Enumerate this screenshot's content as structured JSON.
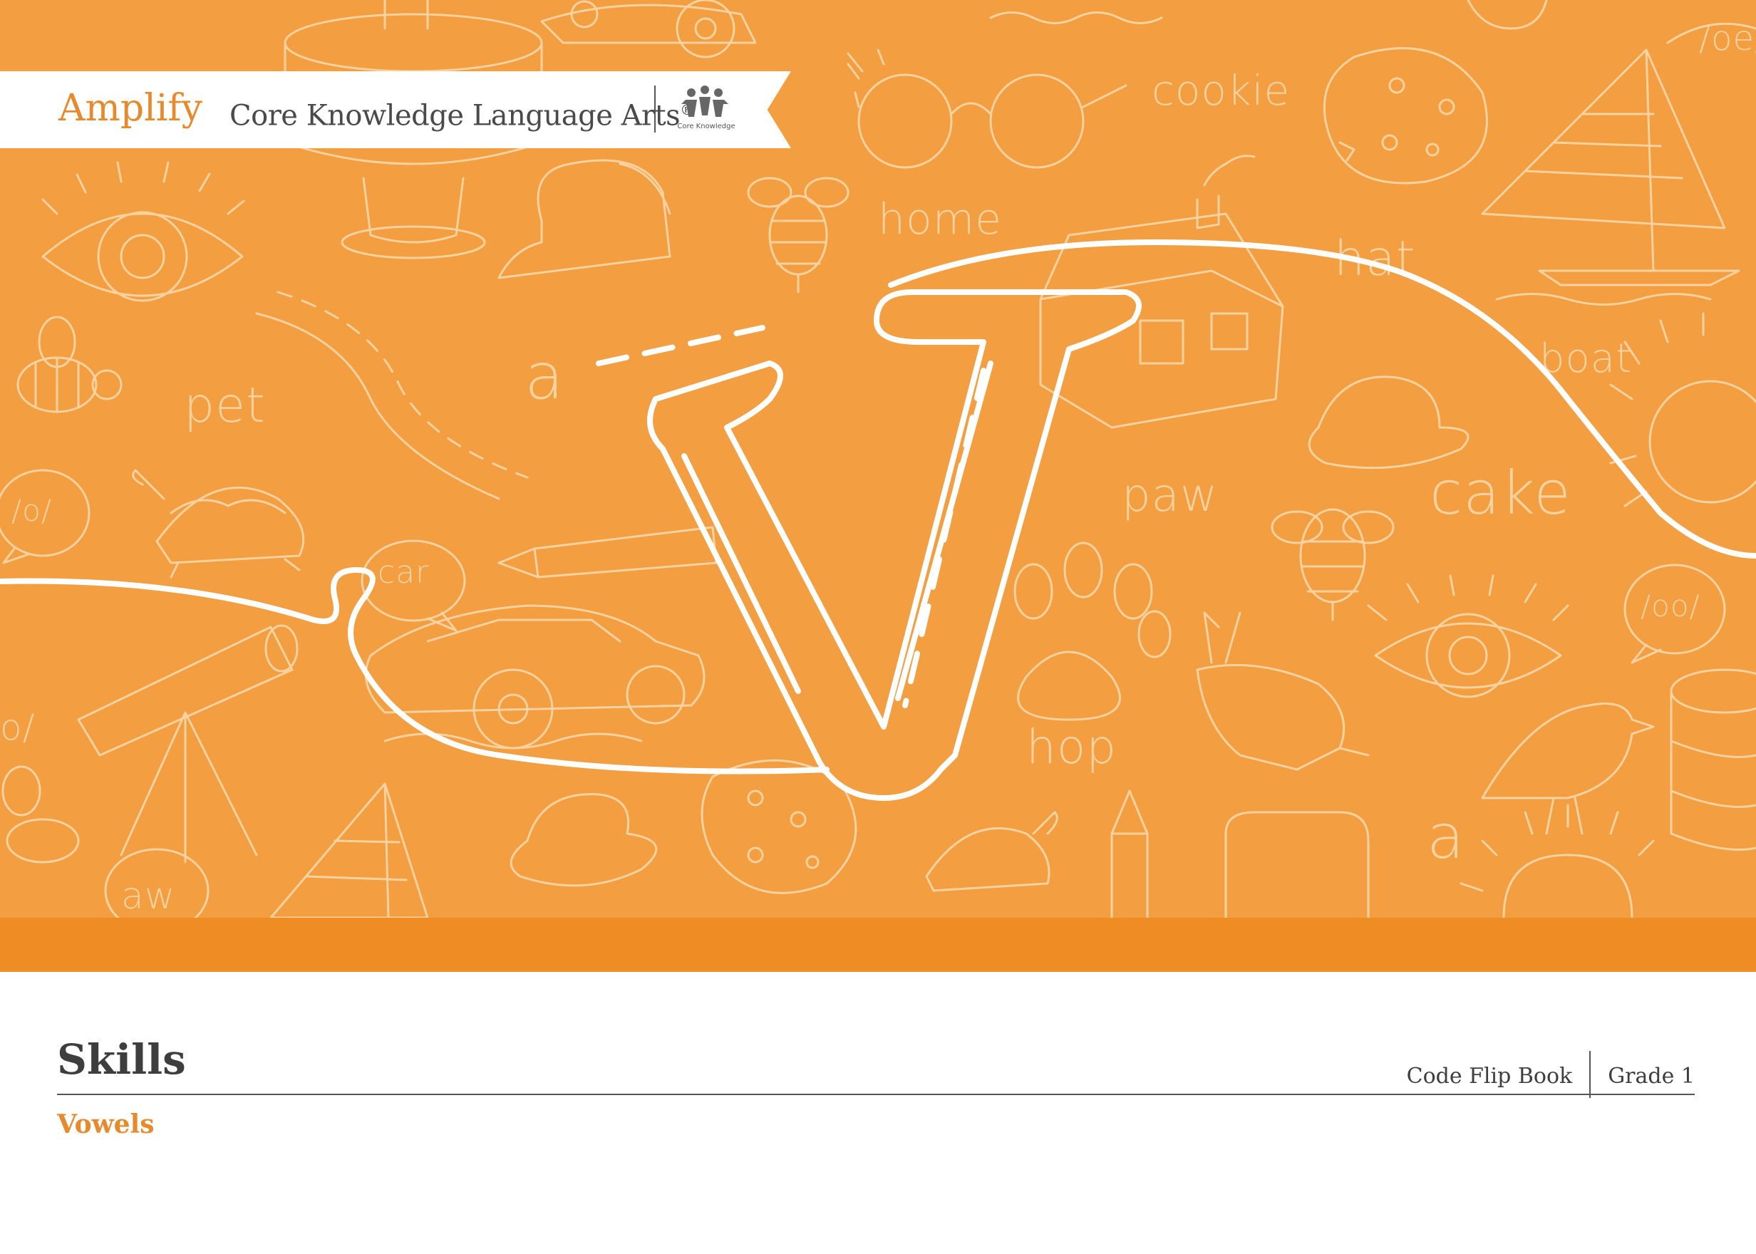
{
  "brand": {
    "publisher": "Amplify",
    "program": "Core Knowledge Language Arts",
    "registered_mark": "®",
    "partner_logo_label": "Core Knowledge"
  },
  "cover": {
    "letter": "V",
    "doodle_words": [
      "cookie",
      "home",
      "hat",
      "boat",
      "pet",
      "a",
      "paw",
      "cake",
      "/o/",
      "car",
      "/oo/",
      "hop",
      "aw",
      "a",
      "/oe/",
      "o/"
    ]
  },
  "footer": {
    "title": "Skills",
    "subtitle": "Vowels",
    "book_type": "Code Flip Book",
    "grade": "Grade 1"
  },
  "colors": {
    "cover_orange": "#f29e41",
    "band_orange": "#ef8c23",
    "accent": "#e88a2c",
    "text_dark": "#3e3e3e"
  }
}
